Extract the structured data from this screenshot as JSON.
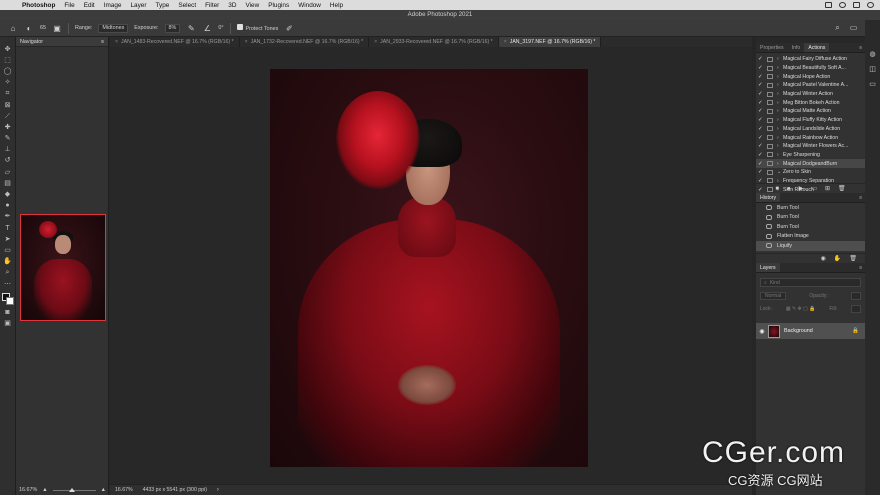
{
  "menubar": {
    "app": "Photoshop",
    "items": [
      "File",
      "Edit",
      "Image",
      "Layer",
      "Type",
      "Select",
      "Filter",
      "3D",
      "View",
      "Plugins",
      "Window",
      "Help"
    ]
  },
  "window": {
    "title": "Adobe Photoshop 2021"
  },
  "options": {
    "brush_size": "65",
    "range_label": "Range:",
    "range_value": "Midtones",
    "exposure_label": "Exposure:",
    "exposure_value": "8%",
    "angle_value": "0°",
    "protect_tones": "Protect Tones"
  },
  "navigator": {
    "title": "Navigator",
    "zoom": "16.67%"
  },
  "tabs": [
    {
      "label": "JAN_1483-Recovered.NEF @ 16.7% (RGB/16) *"
    },
    {
      "label": "JAN_1732-Recovered.NEF @ 16.7% (RGB/16) *"
    },
    {
      "label": "JAN_2933-Recovered.NEF @ 16.7% (RGB/16) *"
    },
    {
      "label": "JAN_3197.NEF @ 16.7% (RGB/16) *"
    }
  ],
  "status": {
    "zoom": "16.67%",
    "doc_info": "4433 px x 5541 px (300 ppi)"
  },
  "actions_panel": {
    "tabs": [
      "Properties",
      "Info",
      "Actions"
    ],
    "items": [
      {
        "label": "Magical Fairy Diffuse Action"
      },
      {
        "label": "Magical Beautifully Soft A..."
      },
      {
        "label": "Magical Hope Action"
      },
      {
        "label": "Magical Pastel Valentine A..."
      },
      {
        "label": "Magical Winter Action"
      },
      {
        "label": "Meg Bitton Bokeh Action"
      },
      {
        "label": "Magical Matte Action"
      },
      {
        "label": "Magical Fluffy Kitty Action"
      },
      {
        "label": "Magical Landslide Action"
      },
      {
        "label": "Magical Rainbow Action"
      },
      {
        "label": "Magical Winter Flowers Ac..."
      },
      {
        "label": "Eye Sharpening"
      },
      {
        "label": "Magical DodgeandBurn"
      },
      {
        "label": "Zero to Skin"
      },
      {
        "label": "Frequency Separation"
      },
      {
        "label": "Skin Retouch"
      }
    ]
  },
  "history_panel": {
    "title": "History",
    "items": [
      {
        "label": "Burn Tool"
      },
      {
        "label": "Burn Tool"
      },
      {
        "label": "Burn Tool"
      },
      {
        "label": "Flatten Image"
      },
      {
        "label": "Liquify"
      }
    ]
  },
  "layers_panel": {
    "title": "Layers",
    "search_placeholder": "Kind",
    "blend_mode": "Normal",
    "opacity_label": "Opacity:",
    "lock_label": "Lock:",
    "fill_label": "Fill:",
    "layer_name": "Background"
  },
  "watermark": {
    "big": "CGer.com",
    "small": "CG资源 CG网站"
  }
}
